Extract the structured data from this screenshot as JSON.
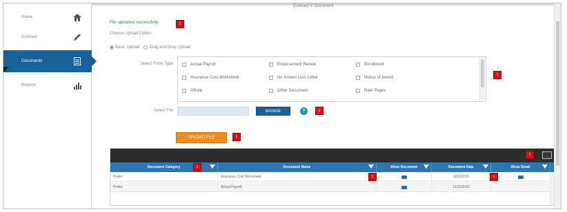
{
  "header": {
    "contract_text": "Contract #: Document"
  },
  "sidebar": {
    "items": [
      {
        "label": "Home",
        "icon": "home-icon"
      },
      {
        "label": "Contract",
        "icon": "pencil-icon"
      },
      {
        "label": "Documents",
        "icon": "document-icon",
        "active": true
      },
      {
        "label": "Reports",
        "icon": "bar-chart-icon"
      }
    ]
  },
  "status": {
    "success": "File uploaded successfully"
  },
  "upload_method": {
    "label": "Choose Upload Option",
    "options": [
      "Basic Upload",
      "Drag and Drop Upload"
    ],
    "selected": "Basic Upload"
  },
  "form_type": {
    "label": "Select Form Type",
    "options": [
      "Actual Payroll",
      "Endorsement Renew",
      "Enrollment",
      "Insurance Cost Worksheet",
      "No Known Loss Letter",
      "Notice of Award",
      "Offsite",
      "Other Document",
      "Rate Pages"
    ]
  },
  "file": {
    "label": "Select File",
    "browse_label": "BROWSE",
    "help_icon": "help-icon"
  },
  "upload_button": {
    "label": "UPLOAD FILE"
  },
  "grid": {
    "columns": [
      "Document Category",
      "Document Name",
      "Show Document",
      "Document Date",
      "Show Email"
    ],
    "rows": [
      {
        "category": "Prefer",
        "name": "Insurance Cost Worksheet",
        "date": "6/22/2016"
      },
      {
        "category": "Prefer",
        "name": "Actual Payroll",
        "date": "11/22/2016"
      }
    ]
  },
  "markers": {
    "label": "1"
  },
  "colors": {
    "sidebar_active": "#17629a",
    "success": "#2e8b3a",
    "upload_button": "#f08a1a",
    "grid_header": "#2c76b5",
    "marker": "#d8101c"
  }
}
